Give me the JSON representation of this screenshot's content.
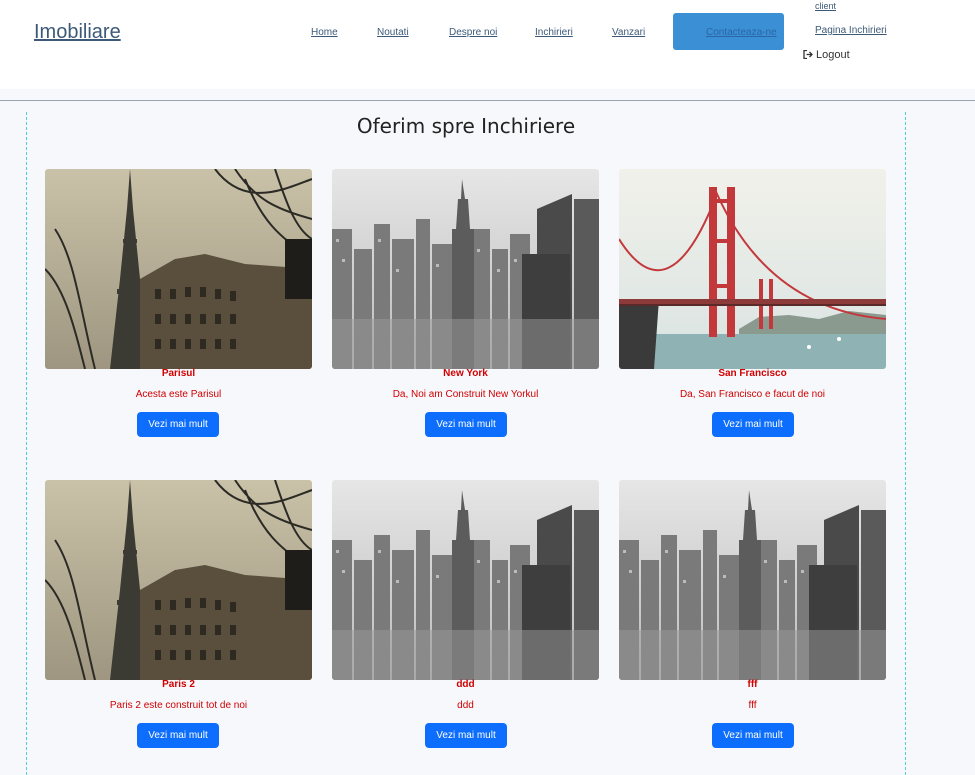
{
  "header": {
    "brand": "Imobiliare",
    "nav": [
      "Home",
      "Noutati",
      "Despre noi",
      "Inchirieri",
      "Vanzari"
    ],
    "contact": "Contacteaza-ne",
    "client": "client",
    "pagina_inchirieri": "Pagina Inchirieri",
    "logout": "Logout"
  },
  "main": {
    "title": "Oferim spre Inchiriere",
    "cards": [
      {
        "name": "Parisul",
        "description": "Acesta este Parisul",
        "button": "Vezi mai mult",
        "image": "paris-eiffel-photo"
      },
      {
        "name": "New York",
        "description": "Da, Noi am Construit New Yorkul",
        "button": "Vezi mai mult",
        "image": "new-york-skyline-photo"
      },
      {
        "name": "San Francisco",
        "description": "Da, San Francisco e facut de noi",
        "button": "Vezi mai mult",
        "image": "golden-gate-bridge-photo"
      },
      {
        "name": "Paris 2",
        "description": "Paris 2 este construit tot de noi",
        "button": "Vezi mai mult",
        "image": "paris-eiffel-photo"
      },
      {
        "name": "ddd",
        "description": "ddd",
        "button": "Vezi mai mult",
        "image": "new-york-skyline-photo"
      },
      {
        "name": "fff",
        "description": "fff",
        "button": "Vezi mai mult",
        "image": "new-york-skyline-photo"
      }
    ]
  },
  "colors": {
    "accent": "#0d6efd",
    "contact_button": "#3b8fd4",
    "card_text": "#d00000"
  }
}
